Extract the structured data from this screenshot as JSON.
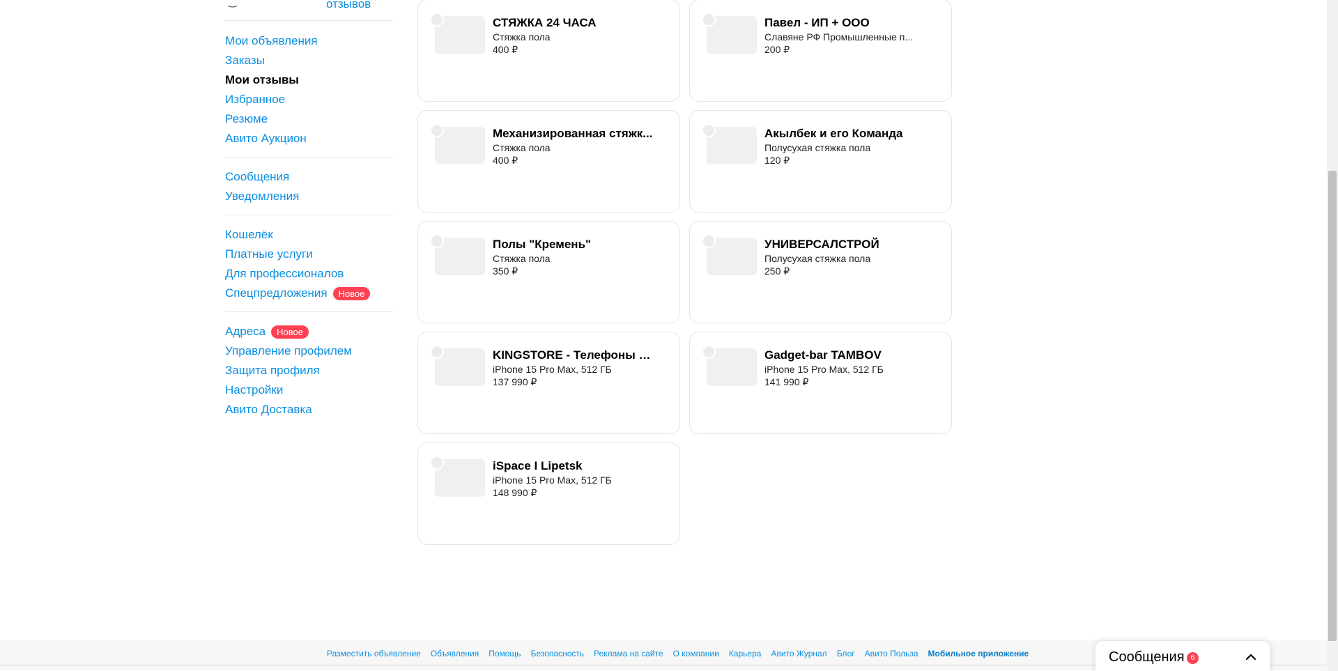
{
  "sidebar": {
    "top_link": "отзывов",
    "groups": [
      [
        {
          "label": "Мои объявления"
        },
        {
          "label": "Заказы"
        },
        {
          "label": "Мои отзывы",
          "active": true
        },
        {
          "label": "Избранное"
        },
        {
          "label": "Резюме"
        },
        {
          "label": "Авито Аукцион"
        }
      ],
      [
        {
          "label": "Сообщения"
        },
        {
          "label": "Уведомления"
        }
      ],
      [
        {
          "label": "Кошелёк"
        },
        {
          "label": "Платные услуги"
        },
        {
          "label": "Для профессионалов"
        },
        {
          "label": "Спецпредложения",
          "badge": "Новое"
        }
      ],
      [
        {
          "label": "Адреса",
          "badge": "Новое"
        },
        {
          "label": "Управление профилем"
        },
        {
          "label": "Защита профиля"
        },
        {
          "label": "Настройки"
        },
        {
          "label": "Авито Доставка"
        }
      ]
    ]
  },
  "cards": [
    {
      "title": "СТЯЖКА 24 ЧАСА",
      "subtitle": "Стяжка пола",
      "price": "400 ₽"
    },
    {
      "title": "Павел - ИП + ООО",
      "subtitle": "Славяне РФ Промышленные п...",
      "price": "200 ₽"
    },
    {
      "title": "Механизированная стяжк...",
      "subtitle": "Стяжка пола",
      "price": "400 ₽"
    },
    {
      "title": "Акылбек и его Команда",
      "subtitle": "Полусухая стяжка пола",
      "price": "120 ₽"
    },
    {
      "title": "Полы \"Кремень\"",
      "subtitle": "Стяжка пола",
      "price": "350 ₽"
    },
    {
      "title": "УНИВЕРСАЛСТРОЙ",
      "subtitle": "Полусухая стяжка пола",
      "price": "250 ₽"
    },
    {
      "title": "KINGSTORE - Телефоны и ...",
      "subtitle": "iPhone 15 Pro Max, 512 ГБ",
      "price": "137 990 ₽"
    },
    {
      "title": "Gadget-bar TAMBOV",
      "subtitle": "iPhone 15 Pro Max, 512 ГБ",
      "price": "141 990 ₽"
    },
    {
      "title": "iSpace I Lipetsk",
      "subtitle": "iPhone 15 Pro Max, 512 ГБ",
      "price": "148 990 ₽"
    }
  ],
  "footer": {
    "links": [
      "Разместить объявление",
      "Объявления",
      "Помощь",
      "Безопасность",
      "Реклама на сайте",
      "О компании",
      "Карьера",
      "Авито Журнал",
      "Блог",
      "Авито Польза",
      "Мобильное приложение"
    ]
  },
  "messenger": {
    "title": "Сообщения",
    "unread": "6",
    "chevron_icon": "chevron-up-icon"
  },
  "colors": {
    "link": "#0a8ee0",
    "badge": "#ff4053"
  }
}
